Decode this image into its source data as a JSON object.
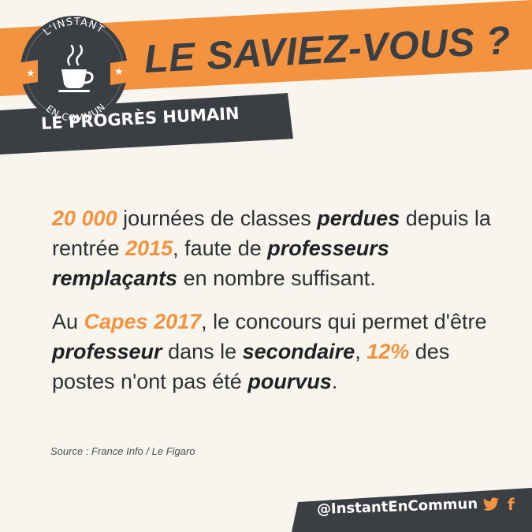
{
  "header": {
    "title": "LE SAVIEZ-VOUS ?",
    "subtitle": "LE PROGRÈS HUMAIN",
    "logo_top": "L'INSTANT",
    "logo_bottom": "EN COMMUN",
    "logo_icon": "coffee-cup-icon"
  },
  "body": {
    "p1": {
      "n1": "20 000",
      "t1": " journées de classes ",
      "e1": "perdues",
      "t2": " depuis la rentrée ",
      "n2": "2015",
      "t3": ", faute de ",
      "e2": "professeurs remplaçants",
      "t4": " en nombre suffisant."
    },
    "p2": {
      "t1": "Au ",
      "n1": "Capes 2017",
      "t2": ", le concours qui permet d'être ",
      "e1": "professeur",
      "t3": " dans le ",
      "e2": "secondaire",
      "t4": ", ",
      "n2": "12%",
      "t5": " des postes n'ont pas été ",
      "e3": "pourvus",
      "t6": "."
    }
  },
  "source": "Source : France Info / Le Figaro",
  "footer": {
    "handle": "@InstantEnCommun",
    "twitter_icon": "twitter-icon",
    "facebook_icon": "facebook-icon",
    "facebook_glyph": "f"
  },
  "colors": {
    "accent": "#f3933f",
    "dark": "#3b3f44",
    "background": "#f8f5ee"
  }
}
